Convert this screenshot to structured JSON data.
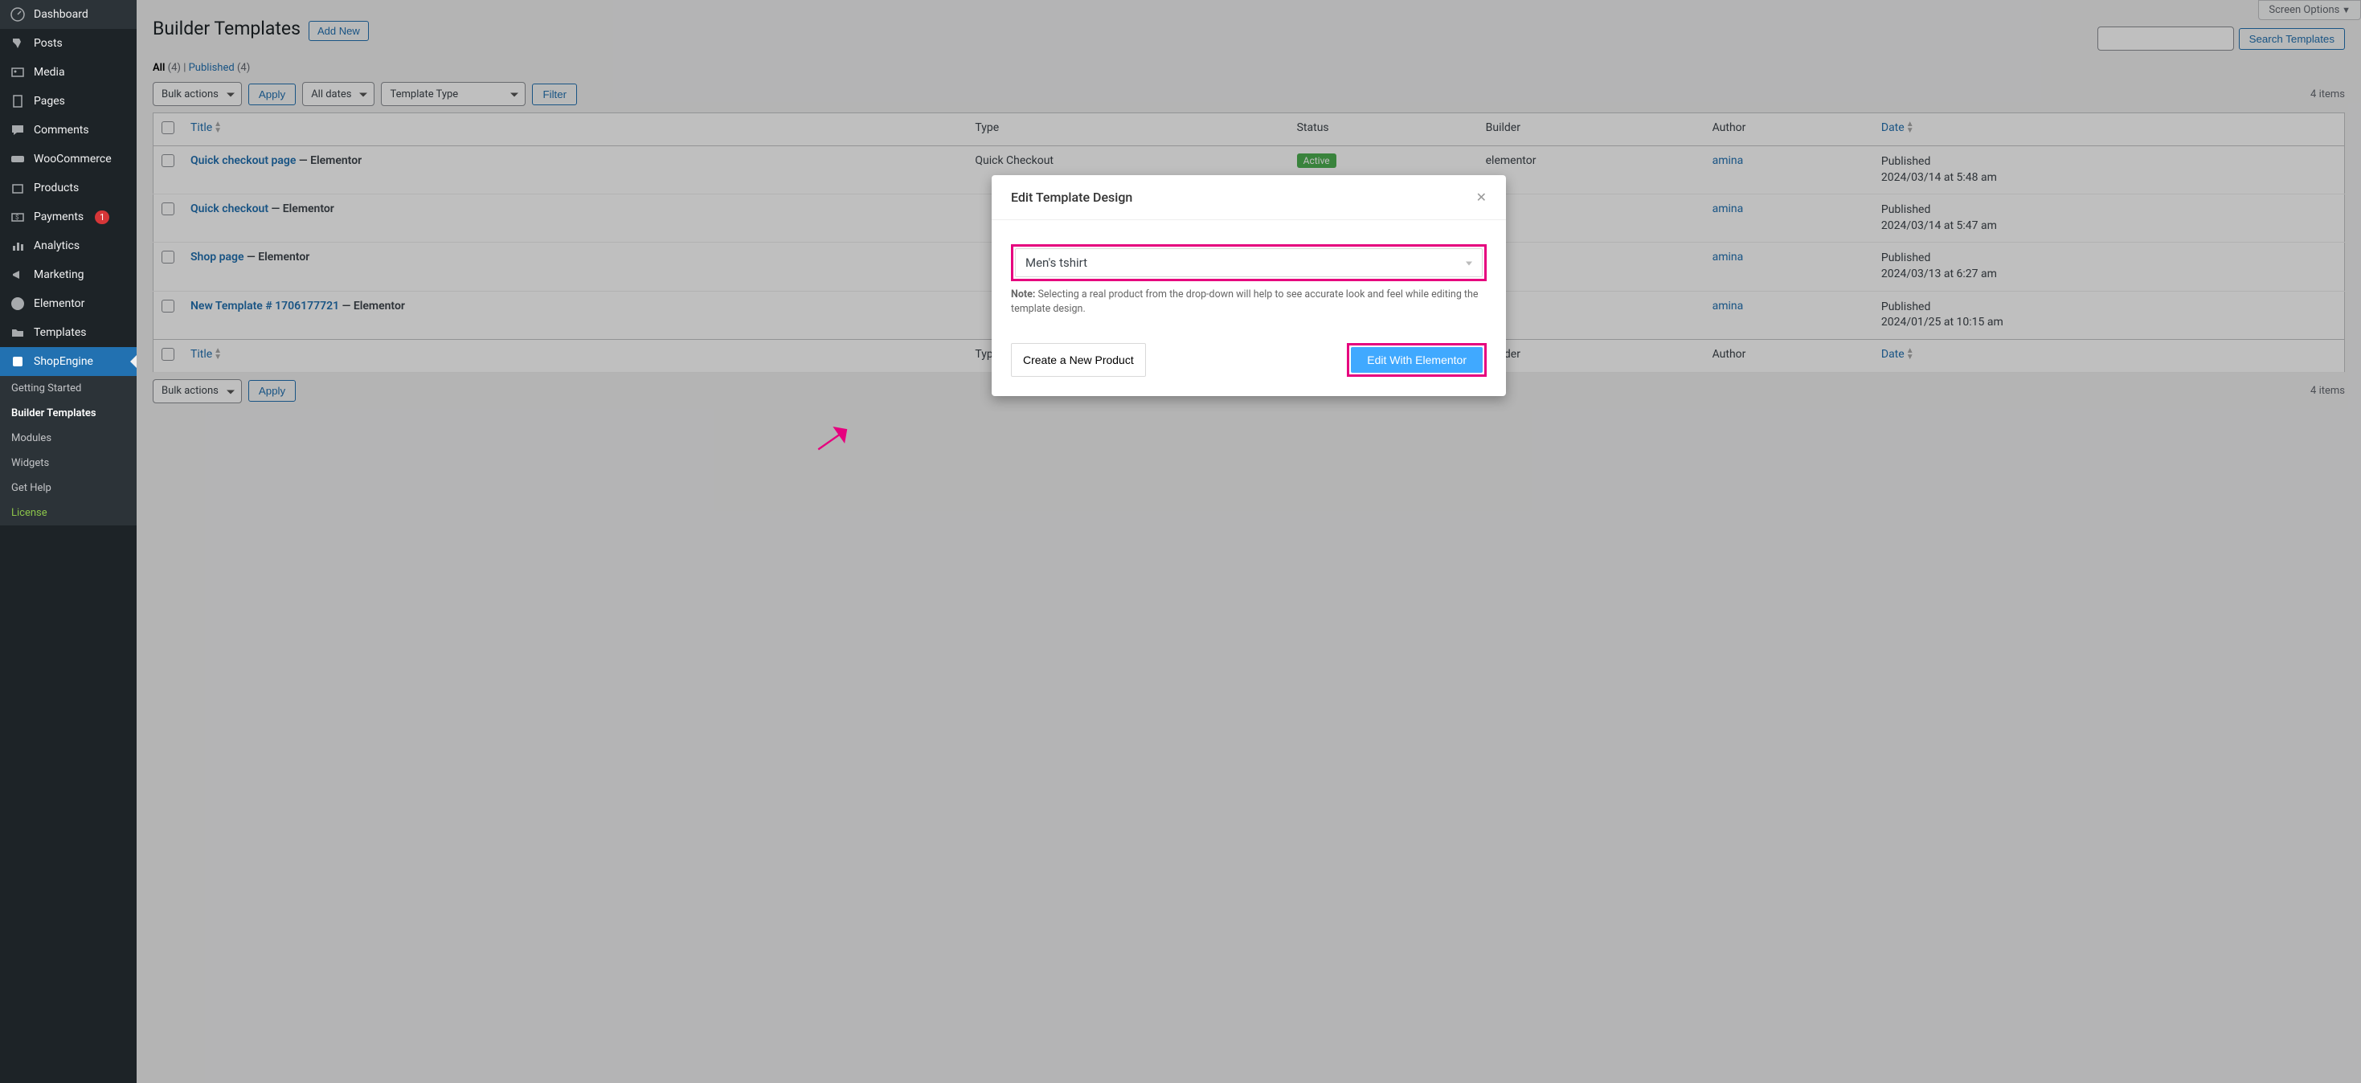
{
  "sidebar": {
    "items": [
      {
        "icon": "dashboard",
        "label": "Dashboard"
      },
      {
        "icon": "posts",
        "label": "Posts"
      },
      {
        "icon": "media",
        "label": "Media"
      },
      {
        "icon": "pages",
        "label": "Pages"
      },
      {
        "icon": "comments",
        "label": "Comments"
      },
      {
        "icon": "woo",
        "label": "WooCommerce"
      },
      {
        "icon": "products",
        "label": "Products"
      },
      {
        "icon": "payments",
        "label": "Payments",
        "badge": "1"
      },
      {
        "icon": "analytics",
        "label": "Analytics"
      },
      {
        "icon": "marketing",
        "label": "Marketing"
      },
      {
        "icon": "elementor",
        "label": "Elementor"
      },
      {
        "icon": "templates",
        "label": "Templates"
      },
      {
        "icon": "shopengine",
        "label": "ShopEngine",
        "active": true
      }
    ],
    "subitems": [
      {
        "label": "Getting Started"
      },
      {
        "label": "Builder Templates",
        "current": true
      },
      {
        "label": "Modules"
      },
      {
        "label": "Widgets"
      },
      {
        "label": "Get Help"
      },
      {
        "label": "License",
        "cls": "license"
      }
    ]
  },
  "header": {
    "page_title": "Builder Templates",
    "add_new": "Add New",
    "screen_options": "Screen Options"
  },
  "subsubsub": {
    "all": "All",
    "all_count": "(4)",
    "sep": " | ",
    "published": "Published",
    "pub_count": "(4)"
  },
  "search": {
    "button": "Search Templates"
  },
  "filters": {
    "bulk": "Bulk actions",
    "apply": "Apply",
    "dates": "All dates",
    "template_type": "Template Type",
    "filter": "Filter",
    "count": "4 items"
  },
  "table": {
    "cols": {
      "title": "Title",
      "type": "Type",
      "status": "Status",
      "builder": "Builder",
      "author": "Author",
      "date": "Date"
    },
    "rows": [
      {
        "title": "Quick checkout page",
        "suffix": " — Elementor",
        "type": "Quick Checkout",
        "status": "Active",
        "builder": "elementor",
        "author": "amina",
        "date_label": "Published",
        "date": "2024/03/14 at 5:48 am"
      },
      {
        "title": "Quick checkout",
        "suffix": " — Elementor",
        "type": "",
        "status": "",
        "builder": "",
        "author": "amina",
        "date_label": "Published",
        "date": "2024/03/14 at 5:47 am"
      },
      {
        "title": "Shop page",
        "suffix": " — Elementor",
        "type": "",
        "status": "",
        "builder": "",
        "author": "amina",
        "date_label": "Published",
        "date": "2024/03/13 at 6:27 am"
      },
      {
        "title": "New Template # 1706177721",
        "suffix": " — Elementor",
        "type": "",
        "status": "",
        "builder": "",
        "author": "amina",
        "date_label": "Published",
        "date": "2024/01/25 at 10:15 am"
      }
    ]
  },
  "modal": {
    "title": "Edit Template Design",
    "product": "Men's tshirt",
    "note_label": "Note:",
    "note": " Selecting a real product from the drop-down will help to see accurate look and feel while editing the template design.",
    "create": "Create a New Product",
    "edit": "Edit With Elementor"
  }
}
